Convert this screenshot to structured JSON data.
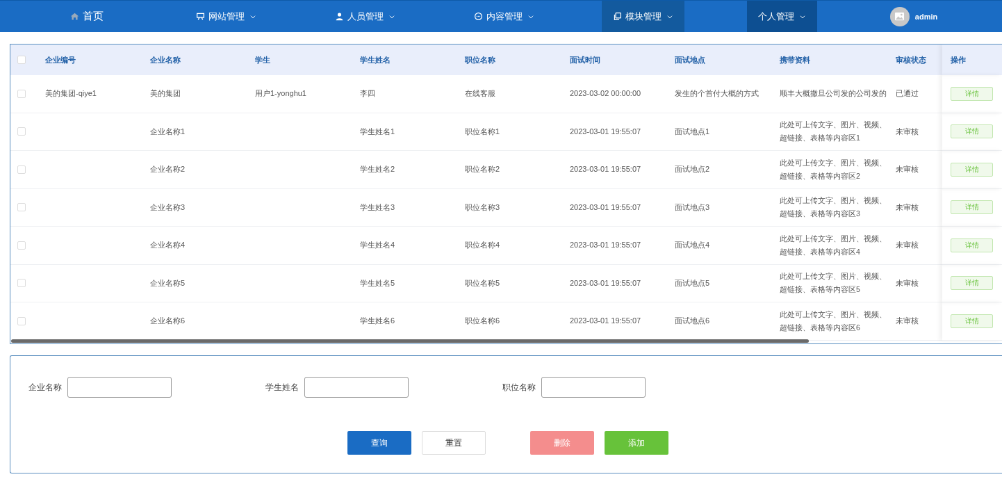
{
  "nav": {
    "items": [
      {
        "label": "首页",
        "dropdown": false,
        "selected": false,
        "hovered": false
      },
      {
        "label": "网站管理",
        "dropdown": true,
        "selected": false,
        "hovered": false
      },
      {
        "label": "人员管理",
        "dropdown": true,
        "selected": false,
        "hovered": false
      },
      {
        "label": "内容管理",
        "dropdown": true,
        "selected": false,
        "hovered": false
      },
      {
        "label": "模块管理",
        "dropdown": true,
        "selected": true,
        "hovered": false
      },
      {
        "label": "个人管理",
        "dropdown": true,
        "selected": false,
        "hovered": true
      }
    ],
    "user": {
      "name": "admin"
    }
  },
  "table": {
    "select_all": {
      "checked": false
    },
    "columns": [
      "企业编号",
      "企业名称",
      "学生",
      "学生姓名",
      "职位名称",
      "面试时间",
      "面试地点",
      "携带资料",
      "审核状态",
      "操作"
    ],
    "rows": [
      {
        "checked": false,
        "cells": [
          "美的集团-qiye1",
          "美的集团",
          "用户1-yonghu1",
          "李四",
          "在线客服",
          "2023-03-02 00:00:00",
          "发生的个首付大概的方式",
          "顺丰大概撒旦公司发的公司发的",
          "已通过"
        ],
        "action": "详情"
      },
      {
        "checked": false,
        "cells": [
          "",
          "企业名称1",
          "",
          "学生姓名1",
          "职位名称1",
          "2023-03-01 19:55:07",
          "面试地点1",
          "此处可上传文字、图片、视频、超链接、表格等内容区1",
          "未审核"
        ],
        "action": "详情"
      },
      {
        "checked": false,
        "cells": [
          "",
          "企业名称2",
          "",
          "学生姓名2",
          "职位名称2",
          "2023-03-01 19:55:07",
          "面试地点2",
          "此处可上传文字、图片、视频、超链接、表格等内容区2",
          "未审核"
        ],
        "action": "详情"
      },
      {
        "checked": false,
        "cells": [
          "",
          "企业名称3",
          "",
          "学生姓名3",
          "职位名称3",
          "2023-03-01 19:55:07",
          "面试地点3",
          "此处可上传文字、图片、视频、超链接、表格等内容区3",
          "未审核"
        ],
        "action": "详情"
      },
      {
        "checked": false,
        "cells": [
          "",
          "企业名称4",
          "",
          "学生姓名4",
          "职位名称4",
          "2023-03-01 19:55:07",
          "面试地点4",
          "此处可上传文字、图片、视频、超链接、表格等内容区4",
          "未审核"
        ],
        "action": "详情"
      },
      {
        "checked": false,
        "cells": [
          "",
          "企业名称5",
          "",
          "学生姓名5",
          "职位名称5",
          "2023-03-01 19:55:07",
          "面试地点5",
          "此处可上传文字、图片、视频、超链接、表格等内容区5",
          "未审核"
        ],
        "action": "详情"
      },
      {
        "checked": false,
        "cells": [
          "",
          "企业名称6",
          "",
          "学生姓名6",
          "职位名称6",
          "2023-03-01 19:55:07",
          "面试地点6",
          "此处可上传文字、图片、视频、超链接、表格等内容区6",
          "未审核"
        ],
        "action": "详情"
      }
    ]
  },
  "search_form": {
    "fields": [
      {
        "label": "企业名称"
      },
      {
        "label": "学生姓名"
      },
      {
        "label": "职位名称"
      }
    ],
    "buttons": [
      {
        "label": "查询",
        "kind": "primary"
      },
      {
        "label": "重置",
        "kind": "plain"
      },
      {
        "label": "删除",
        "kind": "danger"
      },
      {
        "label": "添加",
        "kind": "success"
      }
    ]
  }
}
